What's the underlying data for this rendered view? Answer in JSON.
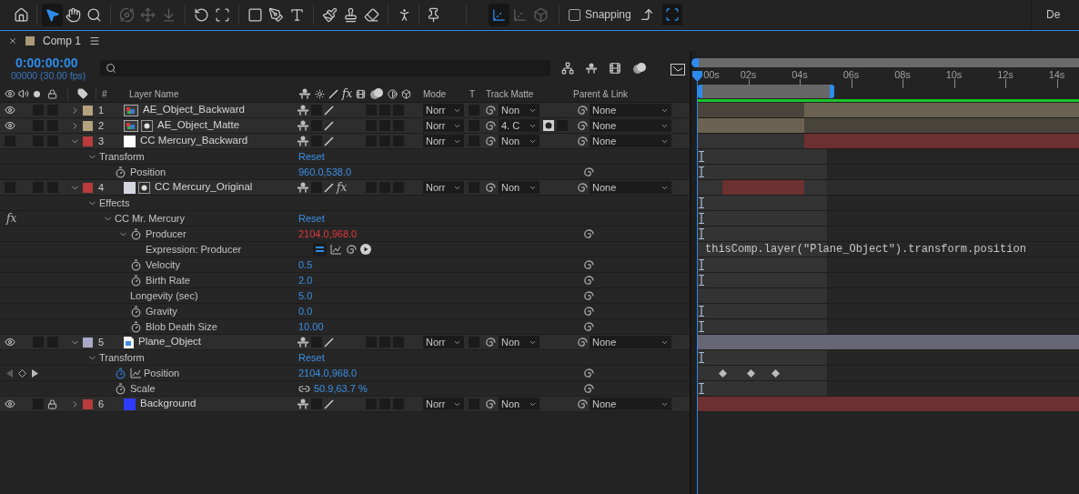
{
  "toolbar": {
    "tools": [
      {
        "selected": false,
        "disabled": false
      },
      {
        "selected": true,
        "disabled": false
      },
      {
        "selected": false,
        "disabled": false
      },
      {
        "selected": false,
        "disabled": false
      },
      {
        "selected": false,
        "disabled": true
      },
      {
        "selected": false,
        "disabled": true
      },
      {
        "selected": false,
        "disabled": true
      },
      {
        "selected": false,
        "disabled": false
      },
      {
        "selected": false,
        "disabled": false
      },
      {
        "selected": false,
        "disabled": false
      },
      {
        "selected": false,
        "disabled": false
      },
      {
        "selected": false,
        "disabled": false
      },
      {
        "selected": false,
        "disabled": false
      },
      {
        "selected": false,
        "disabled": false
      },
      {
        "selected": false,
        "disabled": false
      },
      {
        "selected": false,
        "disabled": false
      },
      {
        "selected": false,
        "disabled": false
      },
      {
        "selected": true,
        "disabled": false
      },
      {
        "selected": false,
        "disabled": true
      },
      {
        "selected": false,
        "disabled": true
      }
    ],
    "snapping": {
      "label": "Snapping",
      "checked": false
    },
    "snap_options": [
      {
        "selected": false
      },
      {
        "selected": true
      }
    ],
    "workspace": "De"
  },
  "panel": {
    "title": "Comp 1"
  },
  "timecode": "0:00:00:00",
  "frame_rate": "00000 (30.00 fps)",
  "columns": {
    "number": "#",
    "name": "Layer Name",
    "fx": "fx",
    "mode": "Mode",
    "t": "T",
    "track_matte": "Track Matte",
    "parent": "Parent & Link"
  },
  "ruler": [
    "00s",
    "02s",
    "04s",
    "06s",
    "08s",
    "10s",
    "12s",
    "14s"
  ],
  "layers": [
    {
      "number": "1",
      "name": "AE_Object_Backward",
      "color": "#b5a27f",
      "visible": true,
      "locked": false,
      "expanded": false,
      "source": {
        "kind": "footage"
      },
      "mode": "Norr",
      "track_matte": "Non",
      "parent": "None",
      "track": {
        "kind": "after"
      }
    },
    {
      "number": "2",
      "name": "AE_Object_Matte",
      "color": "#b5a27f",
      "visible": true,
      "locked": false,
      "expanded": false,
      "source": {
        "kind": "footage",
        "matte": true
      },
      "mode": "Norr",
      "track_matte": "4. C",
      "matte_icon": true,
      "parent": "None",
      "track": {
        "kind": "before"
      }
    },
    {
      "number": "3",
      "name": "CC Mercury_Backward",
      "color": "#b93b3b",
      "visible": false,
      "locked": false,
      "expanded": true,
      "source": {
        "kind": "solid",
        "color": "#ffffff"
      },
      "mode": "Norr",
      "track_matte": "Non",
      "parent": "None",
      "track": {
        "kind": "after_only"
      },
      "children": [
        {
          "kind": "group",
          "name": "Transform",
          "reset": "Reset",
          "expanded": true,
          "marker": true,
          "children": [
            {
              "kind": "property",
              "name": "Position",
              "value": "960.0,538.0",
              "stopwatch": true,
              "animated": false,
              "marker": true
            }
          ]
        }
      ]
    },
    {
      "number": "4",
      "name": "CC Mercury_Original",
      "color": "#b93b3b",
      "visible": false,
      "locked": false,
      "expanded": true,
      "source": {
        "kind": "solid",
        "color": "#d6d6e0",
        "matte": true
      },
      "fx": {
        "label": "fx",
        "on": true
      },
      "mode": "Norr",
      "track_matte": "Non",
      "parent": "None",
      "track": {
        "kind": "clip"
      },
      "children": [
        {
          "kind": "group",
          "name": "Effects",
          "expanded": true,
          "marker": true,
          "children": [
            {
              "kind": "effect",
              "name": "CC Mr. Mercury",
              "switch": {
                "label": "fx",
                "on": true
              },
              "reset": "Reset",
              "expanded": true,
              "marker": true,
              "children": [
                {
                  "kind": "property",
                  "name": "Producer",
                  "value": "2104.0,968.0",
                  "stopwatch": true,
                  "animated": false,
                  "expression": true,
                  "expanded": true,
                  "marker": true,
                  "children": [
                    {
                      "kind": "expression",
                      "name": "Expression: Producer",
                      "code": "thisComp.layer(\"Plane_Object\").transform.position"
                    }
                  ]
                },
                {
                  "kind": "property",
                  "name": "Velocity",
                  "value": "0.5",
                  "stopwatch": true,
                  "animated": false,
                  "marker": true
                },
                {
                  "kind": "property",
                  "name": "Birth Rate",
                  "value": "2.0",
                  "stopwatch": true,
                  "animated": false,
                  "marker": true
                },
                {
                  "kind": "property",
                  "name": "Longevity (sec)",
                  "value": "5.0"
                },
                {
                  "kind": "property",
                  "name": "Gravity",
                  "value": "0.0",
                  "stopwatch": true,
                  "animated": false,
                  "marker": true
                },
                {
                  "kind": "property",
                  "name": "Blob Death Size",
                  "value": "10.00",
                  "stopwatch": true,
                  "animated": false,
                  "marker": true
                }
              ]
            }
          ]
        }
      ]
    },
    {
      "number": "5",
      "name": "Plane_Object",
      "color": "#a9a9c9",
      "visible": true,
      "locked": false,
      "expanded": true,
      "source": {
        "kind": "image"
      },
      "mode": "Norr",
      "track_matte": "Non",
      "parent": "None",
      "track": {
        "kind": "full"
      },
      "children": [
        {
          "kind": "group",
          "name": "Transform",
          "reset": "Reset",
          "expanded": true,
          "marker": true,
          "children": [
            {
              "kind": "property",
              "name": "Position",
              "value": "2104.0,968.0",
              "stopwatch": true,
              "animated": true,
              "graph": true,
              "keyframes": true
            },
            {
              "kind": "property",
              "name": "Scale",
              "value": "50.9,63.7 %",
              "stopwatch": true,
              "animated": false,
              "linked": true,
              "marker": true
            }
          ]
        }
      ]
    },
    {
      "number": "6",
      "name": "Background",
      "color": "#b93b3b",
      "visible": true,
      "locked": true,
      "expanded": false,
      "source": {
        "kind": "solid",
        "color": "#2f3cff"
      },
      "mode": "Norr",
      "track_matte": "Non",
      "parent": "None",
      "track": {
        "kind": "full"
      }
    }
  ]
}
